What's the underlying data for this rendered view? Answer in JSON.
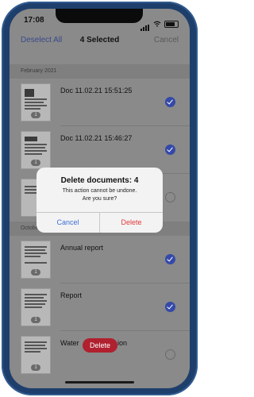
{
  "status": {
    "time": "17:08"
  },
  "nav": {
    "deselect_all": "Deselect All",
    "title": "4 Selected",
    "cancel": "Cancel"
  },
  "sections": [
    {
      "header": "February 2021"
    },
    {
      "header": "Octobe"
    }
  ],
  "documents": [
    {
      "name": "Doc 11.02.21 15:51:25",
      "selected": true,
      "pages": "1"
    },
    {
      "name": "Doc 11.02.21 15:46:27",
      "selected": true,
      "pages": "1"
    },
    {
      "name": "",
      "selected": false,
      "pages": ""
    },
    {
      "name": "Annual report",
      "selected": true,
      "pages": "1"
    },
    {
      "name": "Report",
      "selected": true,
      "pages": "1"
    },
    {
      "name": "Water",
      "name_tail": "ion",
      "selected": false,
      "pages": "1"
    }
  ],
  "swipe_delete": {
    "label": "Delete"
  },
  "dialog": {
    "title": "Delete documents: 4",
    "line1": "This action cannot be undone.",
    "line2": "Are you sure?",
    "cancel": "Cancel",
    "delete": "Delete"
  },
  "colors": {
    "accent": "#3549a8",
    "destructive": "#e23a3a",
    "swipe_delete": "#b0202f"
  }
}
